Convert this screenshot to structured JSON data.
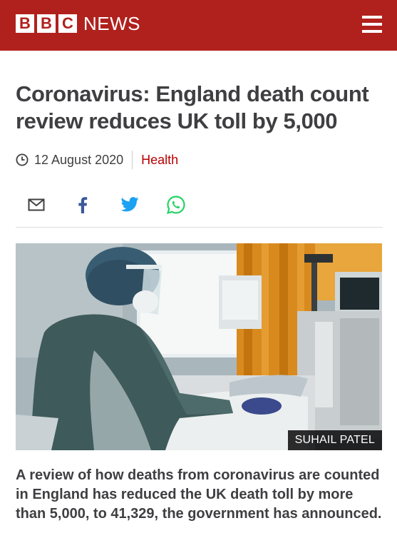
{
  "header": {
    "logo_letters": [
      "B",
      "B",
      "C"
    ],
    "logo_word": "NEWS",
    "menu_icon": "hamburger-menu-icon",
    "brand_color": "#b0211d"
  },
  "article": {
    "headline": "Coronavirus: England death count review reduces UK toll by 5,000",
    "date": "12 August 2020",
    "topic": "Health",
    "topic_color": "#b80000"
  },
  "share": {
    "icons": [
      "email-icon",
      "facebook-icon",
      "twitter-icon",
      "whatsapp-icon"
    ]
  },
  "image": {
    "description_icon": "hospital-photo",
    "credit": "SUHAIL PATEL"
  },
  "intro": "A review of how deaths from coronavirus are counted in England has reduced the UK death toll by more than 5,000, to 41,329, the government has announced."
}
